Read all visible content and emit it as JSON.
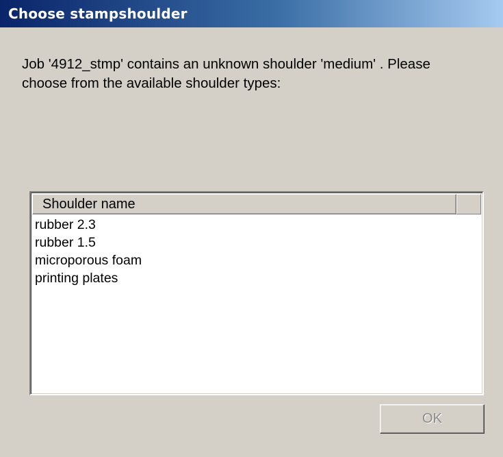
{
  "window": {
    "title": "Choose stampshoulder"
  },
  "message": {
    "text": "Job  '4912_stmp' contains an unknown shoulder 'medium' . Please choose from the available shoulder types:"
  },
  "list": {
    "column_header": "Shoulder name",
    "items": [
      {
        "label": "rubber 2.3"
      },
      {
        "label": "rubber 1.5"
      },
      {
        "label": "microporous foam"
      },
      {
        "label": "printing plates"
      }
    ]
  },
  "buttons": {
    "ok_label": "OK",
    "ok_enabled": false
  },
  "colors": {
    "title_gradient_start": "#0a246a",
    "title_gradient_end": "#a6caf0",
    "dialog_background": "#d4d0c8",
    "disabled_text": "#8a8a8a"
  }
}
